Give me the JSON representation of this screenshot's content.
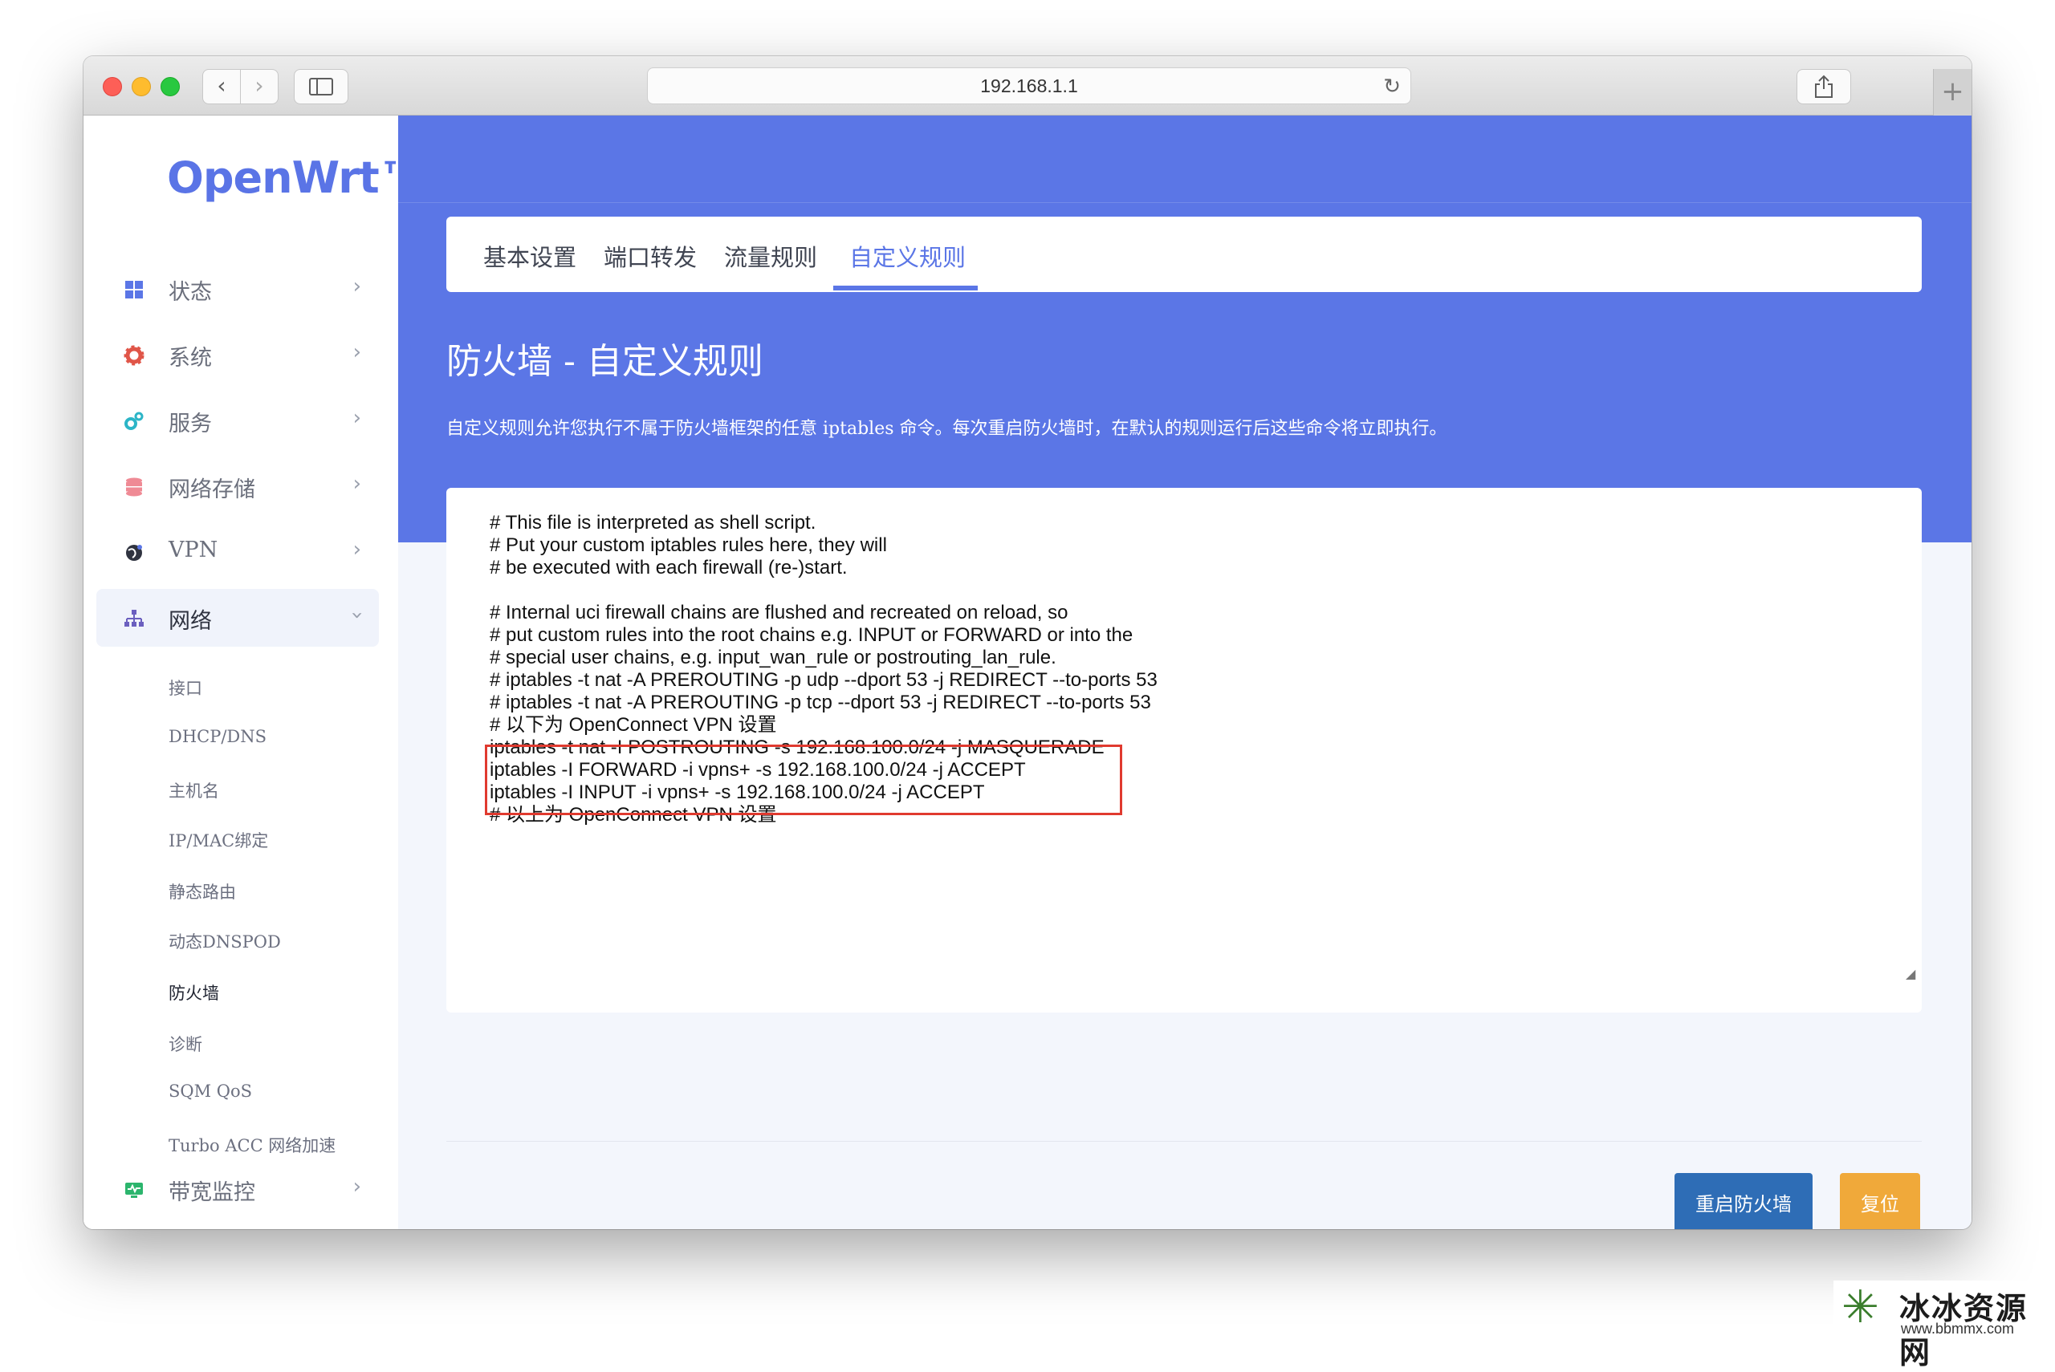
{
  "browser": {
    "url": "192.168.1.1",
    "back_glyph": "‹",
    "forward_glyph": "›",
    "reload_glyph": "↻",
    "newtab_glyph": "+"
  },
  "sidebar": {
    "brand": "OpenWrt™",
    "menu": [
      {
        "label": "状态",
        "icon": "dashboard-icon",
        "color": "#5b76e6"
      },
      {
        "label": "系统",
        "icon": "gear-icon",
        "color": "#e05548"
      },
      {
        "label": "服务",
        "icon": "services-icon",
        "color": "#2cb5c7"
      },
      {
        "label": "网络存储",
        "icon": "database-icon",
        "color": "#ef8a95"
      },
      {
        "label": "VPN",
        "icon": "vpn-globe-icon",
        "color": "#2f3340"
      },
      {
        "label": "网络",
        "icon": "network-tree-icon",
        "color": "#6b5fbf"
      },
      {
        "label": "带宽监控",
        "icon": "monitor-icon",
        "color": "#2cb56d"
      }
    ],
    "network_submenu": [
      "接口",
      "DHCP/DNS",
      "主机名",
      "IP/MAC绑定",
      "静态路由",
      "动态DNSPOD",
      "防火墙",
      "诊断",
      "SQM QoS",
      "Turbo ACC 网络加速"
    ]
  },
  "tabs": [
    "基本设置",
    "端口转发",
    "流量规则",
    "自定义规则"
  ],
  "active_tab": "自定义规则",
  "page": {
    "title": "防火墙 - 自定义规则",
    "description": "自定义规则允许您执行不属于防火墙框架的任意 iptables 命令。每次重启防火墙时，在默认的规则运行后这些命令将立即执行。"
  },
  "editor": {
    "lines_before": [
      "# This file is interpreted as shell script.",
      "# Put your custom iptables rules here, they will",
      "# be executed with each firewall (re-)start.",
      "",
      "# Internal uci firewall chains are flushed and recreated on reload, so",
      "# put custom rules into the root chains e.g. INPUT or FORWARD or into the",
      "# special user chains, e.g. input_wan_rule or postrouting_lan_rule.",
      "# iptables -t nat -A PREROUTING -p udp --dport 53 -j REDIRECT --to-ports 53",
      "# iptables -t nat -A PREROUTING -p tcp --dport 53 -j REDIRECT --to-ports 53",
      "# 以下为 OpenConnect VPN 设置"
    ],
    "highlighted_lines": [
      "iptables -t nat -I POSTROUTING -s 192.168.100.0/24 -j MASQUERADE",
      "iptables -I FORWARD -i vpns+ -s 192.168.100.0/24 -j ACCEPT",
      "iptables -I INPUT -i vpns+ -s 192.168.100.0/24 -j ACCEPT"
    ],
    "lines_after": [
      "# 以上为 OpenConnect VPN 设置"
    ]
  },
  "buttons": {
    "restart": "重启防火墙",
    "reset": "复位"
  },
  "watermark": {
    "text": "冰冰资源网",
    "url": "www.bbmmx.com"
  },
  "colors": {
    "accent": "#5b76e6",
    "restart_button": "#2e6db6",
    "reset_button": "#f0a93a",
    "highlight_box": "#e03a2f"
  }
}
